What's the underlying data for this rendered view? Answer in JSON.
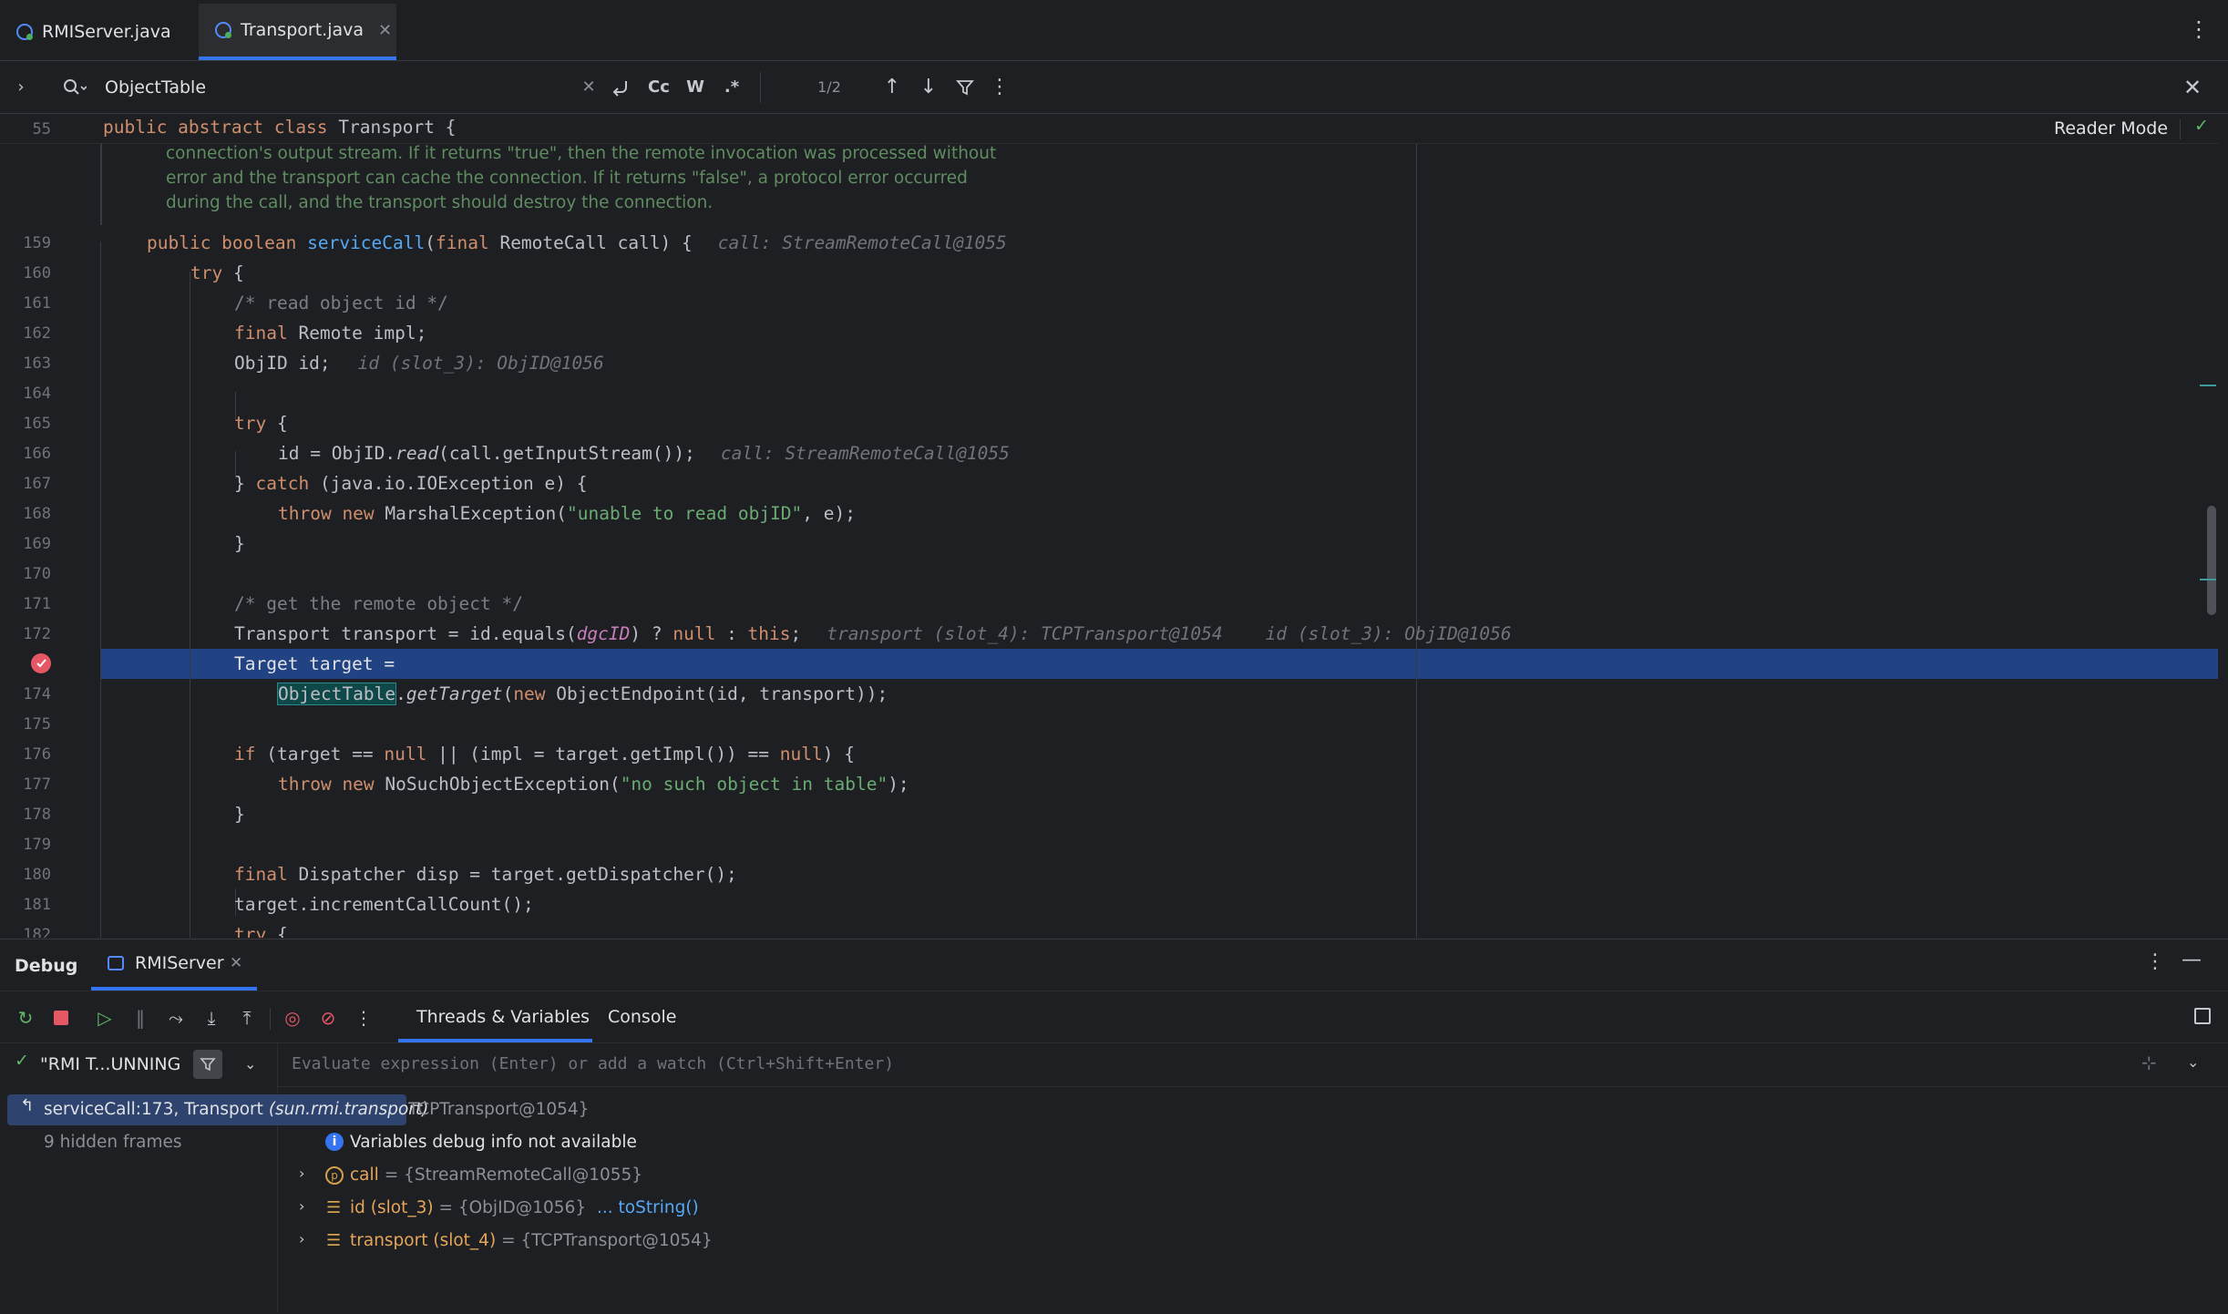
{
  "tabs": [
    {
      "label": "RMIServer.java",
      "active": false
    },
    {
      "label": "Transport.java",
      "active": true
    }
  ],
  "search": {
    "query": "ObjectTable",
    "match_count": "1/2",
    "case_label": "Cc",
    "word_label": "W",
    "regex_label": ".*"
  },
  "editor": {
    "reader_mode_label": "Reader Mode",
    "sticky_line_number": "55",
    "sticky_code": "public abstract class Transport {",
    "doc_comment": [
      "connection's output stream. If it returns \"true\", then the remote invocation was processed without",
      "error and the transport can cache the connection. If it returns \"false\", a protocol error occurred",
      "during the call, and the transport should destroy the connection."
    ],
    "lines": [
      {
        "n": "159",
        "code": "public boolean serviceCall(final RemoteCall call) {",
        "hint": "call: StreamRemoteCall@1055"
      },
      {
        "n": "160",
        "code": "try {"
      },
      {
        "n": "161",
        "code": "/* read object id */"
      },
      {
        "n": "162",
        "code": "final Remote impl;"
      },
      {
        "n": "163",
        "code": "ObjID id;",
        "hint": "id (slot_3): ObjID@1056"
      },
      {
        "n": "164",
        "code": ""
      },
      {
        "n": "165",
        "code": "try {"
      },
      {
        "n": "166",
        "code": "id = ObjID.read(call.getInputStream());",
        "hint": "call: StreamRemoteCall@1055"
      },
      {
        "n": "167",
        "code": "} catch (java.io.IOException e) {"
      },
      {
        "n": "168",
        "code": "throw new MarshalException(\"unable to read objID\", e);"
      },
      {
        "n": "169",
        "code": "}"
      },
      {
        "n": "170",
        "code": ""
      },
      {
        "n": "171",
        "code": "/* get the remote object */"
      },
      {
        "n": "172",
        "code": "Transport transport = id.equals(dgcID) ? null : this;",
        "hint": "transport (slot_4): TCPTransport@1054    id (slot_3): ObjID@1056"
      },
      {
        "n": "173",
        "code": "Target target ="
      },
      {
        "n": "174",
        "code": "ObjectTable.getTarget(new ObjectEndpoint(id, transport));"
      },
      {
        "n": "175",
        "code": ""
      },
      {
        "n": "176",
        "code": "if (target == null || (impl = target.getImpl()) == null) {"
      },
      {
        "n": "177",
        "code": "throw new NoSuchObjectException(\"no such object in table\");"
      },
      {
        "n": "178",
        "code": "}"
      },
      {
        "n": "179",
        "code": ""
      },
      {
        "n": "180",
        "code": "final Dispatcher disp = target.getDispatcher();"
      },
      {
        "n": "181",
        "code": "target.incrementCallCount();"
      },
      {
        "n": "182",
        "code": "try {"
      }
    ]
  },
  "debug": {
    "title": "Debug",
    "session_tab": "RMIServer",
    "subtabs": [
      "Threads & Variables",
      "Console"
    ],
    "thread_label": "\"RMI T...UNNING",
    "watch_placeholder": "Evaluate expression (Enter) or add a watch (Ctrl+Shift+Enter)",
    "frame_label": "serviceCall:173, Transport",
    "frame_package": "(sun.rmi.transport)",
    "hidden_frames": "9 hidden frames",
    "this_value": "TCPTransport@1054}",
    "info_message": "Variables debug info not available",
    "variables": [
      {
        "name": "call",
        "value": "= {StreamRemoteCall@1055}",
        "extra": ""
      },
      {
        "name": "id (slot_3)",
        "value": "= {ObjID@1056}",
        "extra": "... toString()"
      },
      {
        "name": "transport (slot_4)",
        "value": "= {TCPTransport@1054}",
        "extra": ""
      }
    ]
  },
  "colors": {
    "accent": "#3574f0",
    "highlight_line": "#214283",
    "breakpoint": "#e55765"
  }
}
